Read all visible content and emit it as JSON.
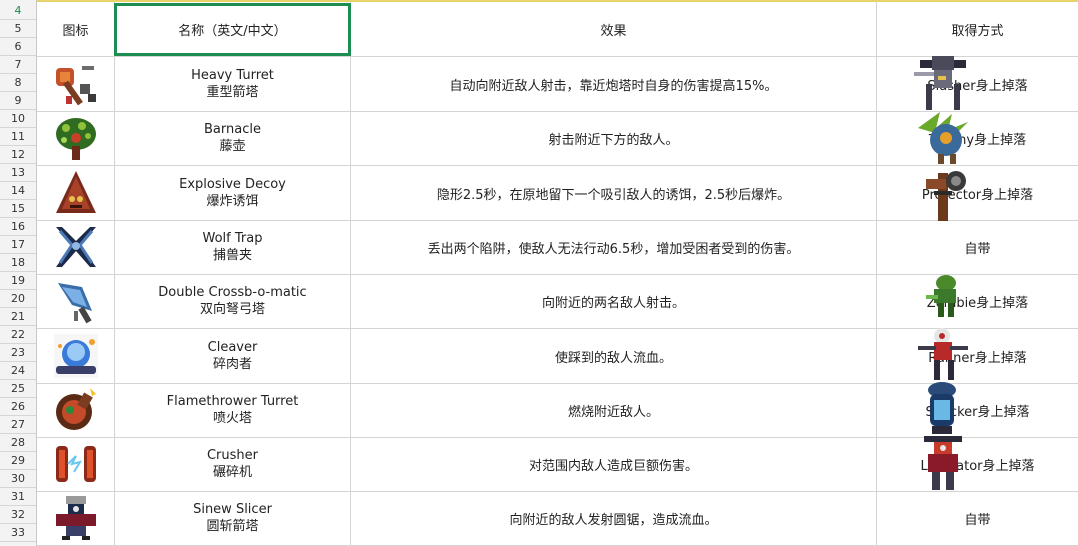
{
  "row_numbers": [
    "4",
    "5",
    "6",
    "7",
    "8",
    "9",
    "10",
    "11",
    "12",
    "13",
    "14",
    "15",
    "16",
    "17",
    "18",
    "19",
    "20",
    "21",
    "22",
    "23",
    "24",
    "25",
    "26",
    "27",
    "28",
    "29",
    "30",
    "31",
    "32",
    "33"
  ],
  "headers": {
    "icon": "图标",
    "name": "名称（英文/中文）",
    "effect": "效果",
    "source": "取得方式"
  },
  "rows": [
    {
      "name_en": "Heavy Turret",
      "name_cn": "重型箭塔",
      "effect": "自动向附近敌人射击，靠近炮塔时自身的伤害提高15%。",
      "source": "Slasher身上掉落",
      "icon": "heavy-turret-icon",
      "drop_char": "slasher-character"
    },
    {
      "name_en": "Barnacle",
      "name_cn": "藤壶",
      "effect": "射击附近下方的敌人。",
      "source": "Thorny身上掉落",
      "icon": "barnacle-icon",
      "drop_char": "thorny-character"
    },
    {
      "name_en": "Explosive Decoy",
      "name_cn": "爆炸诱饵",
      "effect": "隐形2.5秒，在原地留下一个吸引敌人的诱饵，2.5秒后爆炸。",
      "source": "Protector身上掉落",
      "icon": "explosive-decoy-icon",
      "drop_char": "protector-character"
    },
    {
      "name_en": "Wolf Trap",
      "name_cn": "捕兽夹",
      "effect": "丢出两个陷阱，使敌人无法行动6.5秒，增加受困者受到的伤害。",
      "source": "自带",
      "icon": "wolf-trap-icon",
      "drop_char": ""
    },
    {
      "name_en": "Double Crossb-o-matic",
      "name_cn": "双向弩弓塔",
      "effect": "向附近的两名敌人射击。",
      "source": "Zombie身上掉落",
      "icon": "double-crossbomatic-icon",
      "drop_char": "zombie-character"
    },
    {
      "name_en": "Cleaver",
      "name_cn": "碎肉者",
      "effect": "使踩到的敌人流血。",
      "source": "Runner身上掉落",
      "icon": "cleaver-icon",
      "drop_char": "runner-character"
    },
    {
      "name_en": "Flamethrower Turret",
      "name_cn": "喷火塔",
      "effect": "燃烧附近敌人。",
      "source": "Shocker身上掉落",
      "icon": "flamethrower-turret-icon",
      "drop_char": "shocker-character"
    },
    {
      "name_en": "Crusher",
      "name_cn": "碾碎机",
      "effect": "对范围内敌人造成巨额伤害。",
      "source": "Lacerator身上掉落",
      "icon": "crusher-icon",
      "drop_char": "lacerator-character"
    },
    {
      "name_en": "Sinew Slicer",
      "name_cn": "圆斩箭塔",
      "effect": "向附近的敌人发射圆锯，造成流血。",
      "source": "自带",
      "icon": "sinew-slicer-icon",
      "drop_char": ""
    }
  ],
  "colors": {
    "selection_border": "#1e8d52",
    "active_row_number": "#1d8a4d",
    "top_highlight": "#e6d36a"
  }
}
